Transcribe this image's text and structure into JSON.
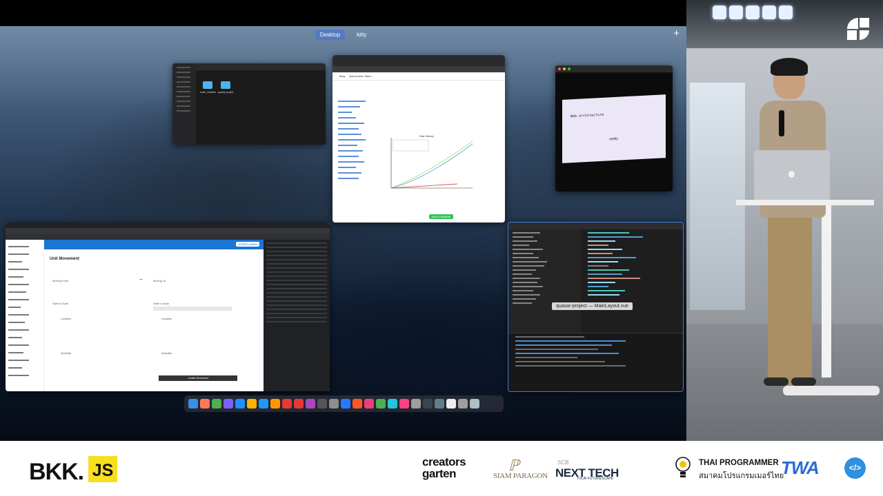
{
  "screen": {
    "spaces": [
      "Desktop",
      "kitty"
    ],
    "active_space": "Desktop",
    "add_space_label": "+",
    "tooltip": "quasar-project — MainLayout.vue",
    "windows": {
      "finder": {
        "folders": [
          "node_modules",
          "quasar-project"
        ]
      },
      "star_history": {
        "nav": [
          "Blog",
          "Add Access Token"
        ],
        "chart_title": "Star History",
        "legend": [
          "quasar-framework/quasar",
          "ionic-team/ionic-framework",
          "vuejs/vue"
        ],
        "button": "Add to Website"
      },
      "video": {
        "slide_title": "Web architecture",
        "slide_label": "netlify"
      },
      "web_app": {
        "admin_button": "SUPER ADMIN",
        "page_title": "Unit Movement",
        "labels": [
          "Moving From",
          "Moving To",
          "Start to Scan",
          "Start to Scan",
          "Location",
          "Location",
          "Quantity",
          "Quantity"
        ],
        "confirm_button": "Confirm Movement"
      }
    },
    "dock_icon_colors": [
      "#3a8ee6",
      "#ff7a59",
      "#4caf50",
      "#7b61ff",
      "#1e90ff",
      "#ffb300",
      "#2196f3",
      "#ff9800",
      "#e53935",
      "#e53935",
      "#ab47bc",
      "#555555",
      "#8e8e8e",
      "#2979ff",
      "#ff5722",
      "#ec407a",
      "#4caf50",
      "#26c6da",
      "#ff4081",
      "#9e9e9e",
      "#37474f",
      "#607d8b",
      "#eeeeee",
      "#9e9e9e",
      "#b0bec5"
    ]
  },
  "sponsors": {
    "bkk": "BKK.",
    "js": "JS",
    "creators_line1": "creators",
    "creators_line2": "garten",
    "siam_paragon": "SIAM PARAGON",
    "scb": "SCB",
    "nexttech": "NEXT TECH",
    "nexttech_sub": "YOUR FUTURESCAPE",
    "thai_programmer_en": "THAI PROGRAMMER",
    "thai_programmer_th": "สมาคมโปรแกรมเมอร์ไทย",
    "twa": "TWA",
    "code_icon": "</>"
  }
}
